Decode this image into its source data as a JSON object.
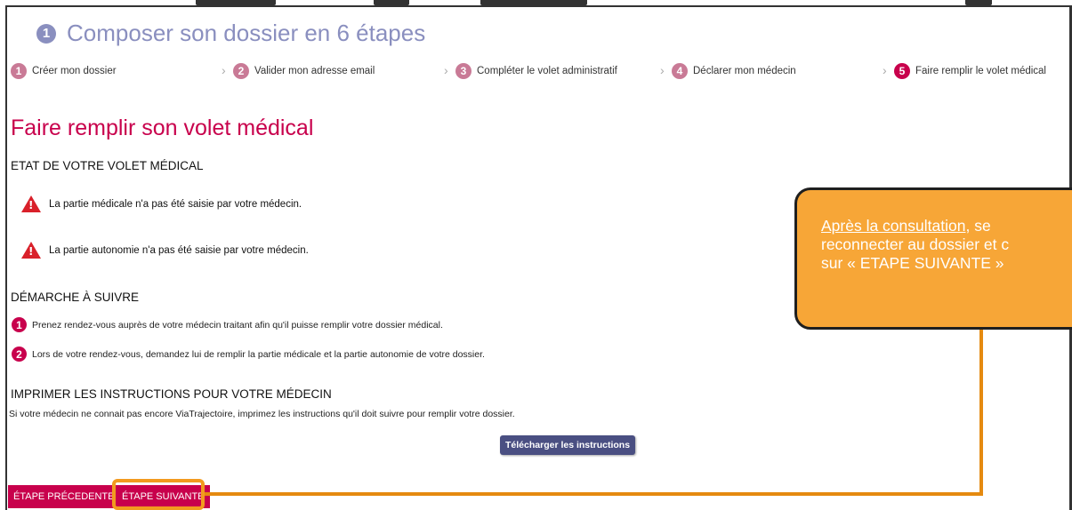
{
  "header": {
    "step_number": "1",
    "title": "Composer son dossier en 6 étapes"
  },
  "steps": [
    {
      "num": "1",
      "label": "Créer mon dossier",
      "state": "done"
    },
    {
      "num": "2",
      "label": "Valider mon adresse email",
      "state": "done"
    },
    {
      "num": "3",
      "label": "Compléter le volet administratif",
      "state": "done"
    },
    {
      "num": "4",
      "label": "Déclarer mon médecin",
      "state": "done"
    },
    {
      "num": "5",
      "label": "Faire remplir le volet médical",
      "state": "active"
    }
  ],
  "page_title": "Faire remplir son volet médical",
  "etat": {
    "title": "ETAT DE VOTRE VOLET MÉDICAL",
    "warnings": [
      "La partie médicale n'a pas été saisie par votre médecin.",
      "La partie autonomie n'a pas été saisie par votre médecin."
    ]
  },
  "demarche": {
    "title": "DÉMARCHE À SUIVRE",
    "items": [
      {
        "num": "1",
        "text": "Prenez rendez-vous auprès de votre médecin traitant afin qu'il puisse remplir votre dossier médical."
      },
      {
        "num": "2",
        "text": "Lors de votre rendez-vous, demandez lui de remplir la partie médicale et la partie autonomie de votre dossier."
      }
    ]
  },
  "imprimer": {
    "title": "IMPRIMER LES INSTRUCTIONS POUR VOTRE MÉDECIN",
    "text": "Si votre médecin ne connait pas encore ViaTrajectoire, imprimez les instructions qu'il doit suivre pour remplir votre dossier.",
    "button_label": "Télécharger les instructions"
  },
  "nav": {
    "prev_label": "ÉTAPE PRÉCEDENTE",
    "next_label": "ÉTAPE SUIVANTE"
  },
  "callout": {
    "link_text": "Après la consultation",
    "rest_line1": ", se",
    "line2": "reconnecter au dossier et c",
    "line3": "sur « ETAPE SUIVANTE »"
  },
  "colors": {
    "accent": "#c8004c",
    "callout": "#f7a637",
    "header": "#8a8fbf",
    "button": "#4a4f82"
  }
}
